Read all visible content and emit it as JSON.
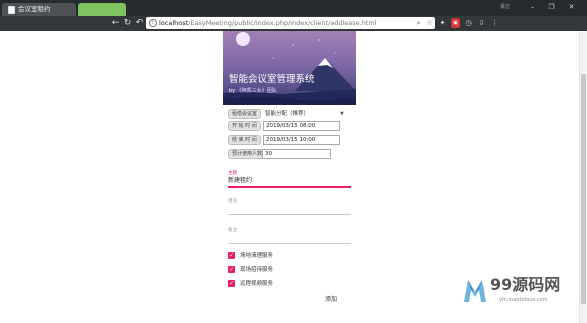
{
  "browser": {
    "tab_title": "会议室租约",
    "window_title": "董志",
    "url_host": "localhost",
    "url_path": "/EasyMeeting/public/index.php/index/client/addlease.html",
    "controls": {
      "minimize": "–",
      "maximize": "❐",
      "close": "✕"
    },
    "nav": {
      "back": "←",
      "reload": "↻",
      "forward": "↶"
    }
  },
  "app": {
    "title": "智能会议室管理系统",
    "subtitle_prefix": "by",
    "subtitle_team": "《阿凯三女》团队",
    "form": {
      "room_label": "租借会议室",
      "room_value": "智能分配（推荐）",
      "start_label": "开 始 时 间",
      "start_value": "2019/03/15 08:00",
      "end_label": "结 束 时 间",
      "end_value": "2019/03/15 10:00",
      "people_label": "预计使用人数",
      "people_value": "30",
      "subject_label": "主题",
      "subject_value": "新建租约",
      "purpose_label": "用途",
      "purpose_value": "",
      "remark_label": "备注",
      "remark_value": ""
    },
    "services": [
      {
        "label": "场地清理服务",
        "checked": true
      },
      {
        "label": "现场招待服务",
        "checked": true
      },
      {
        "label": "远程视频服务",
        "checked": true
      }
    ],
    "submit_label": "添加"
  },
  "watermark": {
    "name": "99源码网",
    "url": "ym.maptoface.com"
  },
  "colors": {
    "accent": "#e91e63",
    "tab_green": "#7ec35e",
    "toolbar": "#32373b"
  }
}
